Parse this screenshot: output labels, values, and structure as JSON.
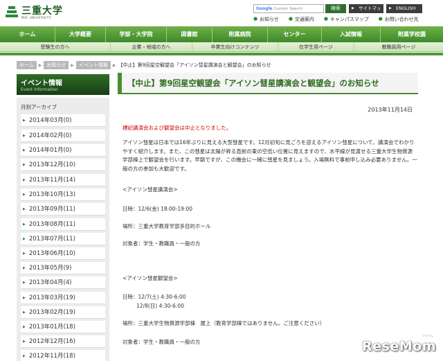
{
  "header": {
    "logo_jp": "三重大学",
    "logo_en": "MIE UNIVERSITY",
    "search_placeholder": "Custom Search",
    "search_brand": "Google",
    "search_button": "検索",
    "sitemap": "サイトマップ",
    "english": "ENGLISH",
    "links": [
      "お知らせ",
      "交通案内",
      "キャンパスマップ",
      "お問い合わせ先"
    ]
  },
  "nav": [
    "ホーム",
    "大学概要",
    "学部・大学院",
    "図書館",
    "附属病院",
    "センター",
    "入試情報",
    "附属学校園"
  ],
  "subnav": [
    "受験生の方へ",
    "企業・地域の方へ",
    "卒業生向けコンテンツ",
    "在学生用ページ",
    "教職員用ページ"
  ],
  "breadcrumb": {
    "items": [
      "ホーム",
      "お知らせ",
      "イベント情報"
    ],
    "current": "【中止】第9回星空観望会「アイソン彗星講演会と観望会」のお知らせ"
  },
  "sidebar": {
    "title": "イベント情報",
    "subtitle": "Event Information",
    "archive_title": "月別アーカイブ",
    "archive": [
      "2014年03月(0)",
      "2014年02月(0)",
      "2014年01月(0)",
      "2013年12月(10)",
      "2013年11月(14)",
      "2013年10月(13)",
      "2013年09月(11)",
      "2013年08月(11)",
      "2013年07月(11)",
      "2013年06月(10)",
      "2013年05月(9)",
      "2013年04月(4)",
      "2013年03月(19)",
      "2013年02月(19)",
      "2013年01月(18)",
      "2012年12月(16)",
      "2012年11月(18)"
    ]
  },
  "article": {
    "title": "【中止】第9回星空観望会「アイソン彗星講演会と観望会」のお知らせ",
    "date": "2013年11月14日",
    "cancel_note": "標記講演会および観望会は中止となりました。",
    "body": "アイソン彗星は日本では16年ぶりに見える大型彗星です。12月初旬に見ごろを迎えるアイソン彗星について、講演会でわかりやすく紹介します。また、この彗星は太陽が昇る直前の東の空低い位置に見えますので、水平線が見渡せる三重大学生物資源学部棟上で観望会を行います。早朝ですが、この機会に一緒に彗星を見ましょう。入場無料で事前申し込み必要ありません。一般の方の参加も大歓迎です。",
    "lecture_heading": "<アイソン彗星講演会>",
    "lecture_date": "日時：12/6(金) 18:00-19:00",
    "lecture_place": "場所：三重大学教育学部多目的ホール",
    "lecture_target": "対象者：学生・教職員・一般の方",
    "viewing_heading": "<アイソン彗星観望会>",
    "viewing_date1": "日時：12/7(土) 4:30-6:00",
    "viewing_date2": "12/8(日) 4:30-6:00",
    "viewing_place": "場所：三重大学生物資源学部棟　屋上（教育学部棟ではありません。ご注意ください）",
    "viewing_target": "対象者：学生・教職員・一般の方"
  },
  "watermark": "ReseMom",
  "watermark_sub": "リセマム"
}
